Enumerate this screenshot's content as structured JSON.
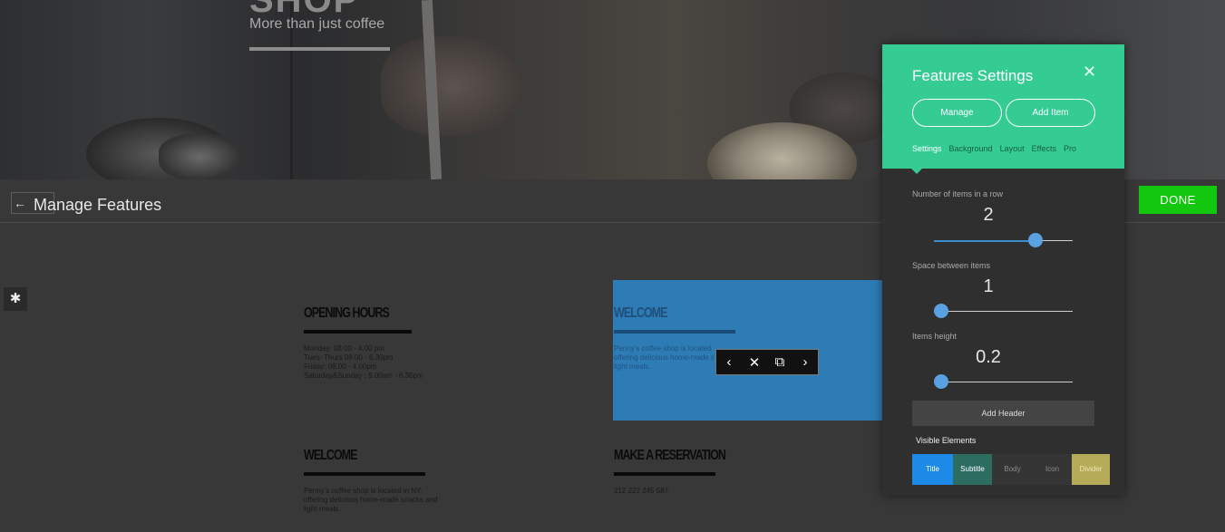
{
  "hero": {
    "title_fragment": "SHOP",
    "subtitle": "More than just coffee"
  },
  "manage_bar": {
    "back_icon": "←",
    "title": "Manage Features",
    "done_label": "DONE"
  },
  "gear_icon": "✱",
  "features": [
    {
      "title": "OPENING HOURS",
      "body": "Monday: 08.00 - 4.00 pm\nTues- Thurs 08.00 - 6.30pm\nFriday: 08.00 - 4.00pm\nSaturday&Sunday : 9.00am - 6.30pm"
    },
    {
      "title": "WELCOME",
      "body": "Penny's coffee shop is located in NY,\noffering delicious home-made snacks and\nlight meals."
    },
    {
      "title": "WELCOME",
      "body": "Penny's coffee shop is located in NY,\noffering delicious home-made snacks and\nlight meals."
    },
    {
      "title": "MAKE A RESERVATION",
      "body": "212 222 245 587"
    }
  ],
  "item_toolbar": {
    "prev_icon": "‹",
    "delete_icon": "✕",
    "duplicate_icon": "⧉",
    "next_icon": "›"
  },
  "panel": {
    "title": "Features Settings",
    "close_icon": "✕",
    "manage_label": "Manage",
    "add_item_label": "Add Item",
    "tabs": [
      "Settings",
      "Background",
      "Layout",
      "Effects",
      "Pro"
    ],
    "active_tab": "Settings",
    "sliders": [
      {
        "label": "Number of items in a row",
        "value": "2",
        "fraction": 0.76
      },
      {
        "label": "Space between items",
        "value": "1",
        "fraction": 0.0
      },
      {
        "label": "Items height",
        "value": "0.2",
        "fraction": 0.0
      }
    ],
    "add_header_label": "Add Header",
    "visible_elements_label": "Visible Elements",
    "visible_elements": [
      {
        "label": "Title",
        "state": "on",
        "color": "#1e8ae8"
      },
      {
        "label": "Subtitle",
        "state": "on",
        "color": "#2d6c61"
      },
      {
        "label": "Body",
        "state": "off"
      },
      {
        "label": "Icon",
        "state": "off"
      },
      {
        "label": "Divider",
        "state": "on",
        "color": "#b6ab58"
      }
    ]
  },
  "colors": {
    "accent_green": "#34cc93",
    "done_green": "#13c70e",
    "selected_blue": "#2b8fd8"
  }
}
